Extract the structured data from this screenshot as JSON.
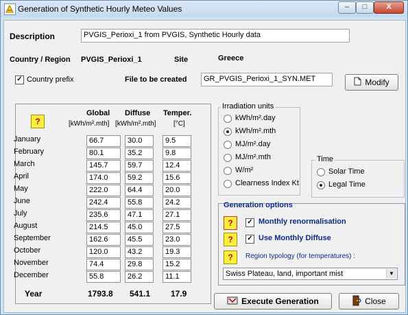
{
  "window": {
    "title": "Generation of Synthetic Hourly Meteo Values",
    "minimize": "–",
    "maximize": "□",
    "close": "X"
  },
  "description": {
    "label": "Description",
    "value": "PVGIS_Perioxi_1  from PVGIS, Synthetic Hourly data"
  },
  "location": {
    "country_label": "Country / Region",
    "country_value": "PVGIS_Perioxi_1",
    "site_label": "Site",
    "site_value": "Greece"
  },
  "country_prefix": {
    "label": "Country prefix",
    "checked": true
  },
  "file": {
    "label": "File to be created",
    "value": "GR_PVGIS_Perioxi_1_SYN.MET",
    "modify_label": "Modify"
  },
  "table": {
    "help": "?",
    "headers": [
      {
        "name": "Global",
        "unit": "[kWh/m².mth]"
      },
      {
        "name": "Diffuse",
        "unit": "[kWh/m².mth]"
      },
      {
        "name": "Temper.",
        "unit": "[°C]"
      }
    ],
    "rows": [
      {
        "month": "January",
        "global": "66.7",
        "diffuse": "30.0",
        "temp": "9.5"
      },
      {
        "month": "February",
        "global": "80.1",
        "diffuse": "35.2",
        "temp": "9.8"
      },
      {
        "month": "March",
        "global": "145.7",
        "diffuse": "59.7",
        "temp": "12.4"
      },
      {
        "month": "April",
        "global": "174.0",
        "diffuse": "59.2",
        "temp": "15.6"
      },
      {
        "month": "May",
        "global": "222.0",
        "diffuse": "64.4",
        "temp": "20.0"
      },
      {
        "month": "June",
        "global": "242.4",
        "diffuse": "55.8",
        "temp": "24.2"
      },
      {
        "month": "July",
        "global": "235.6",
        "diffuse": "47.1",
        "temp": "27.1"
      },
      {
        "month": "August",
        "global": "214.5",
        "diffuse": "45.0",
        "temp": "27.5"
      },
      {
        "month": "September",
        "global": "162.6",
        "diffuse": "45.5",
        "temp": "23.0"
      },
      {
        "month": "October",
        "global": "120.0",
        "diffuse": "43.2",
        "temp": "19.3"
      },
      {
        "month": "November",
        "global": "74.4",
        "diffuse": "29.8",
        "temp": "15.2"
      },
      {
        "month": "December",
        "global": "55.8",
        "diffuse": "26.2",
        "temp": "11.1"
      }
    ],
    "year": {
      "label": "Year",
      "global": "1793.8",
      "diffuse": "541.1",
      "temp": "17.9"
    }
  },
  "irradiation_units": {
    "label": "Irradiation units",
    "options": [
      "kWh/m².day",
      "kWh/m².mth",
      "MJ/m².day",
      "MJ/m².mth",
      "W/m²",
      "Clearness Index Kt"
    ],
    "selected": "kWh/m².mth"
  },
  "time": {
    "label": "Time",
    "options": [
      "Solar Time",
      "Legal Time"
    ],
    "selected": "Legal Time"
  },
  "generation_options": {
    "label": "Generation options",
    "help": "?",
    "monthly_renorm": {
      "label": "Monthly renormalisation",
      "checked": true
    },
    "monthly_diffuse": {
      "label": "Use Monthly Diffuse",
      "checked": true
    },
    "region_label": "Region typology  (for temperatures) :",
    "region_value": "Swiss Plateau, land, important mist"
  },
  "buttons": {
    "execute": "Execute Generation",
    "close": "Close"
  },
  "colors": {
    "title_bar": "#c4d8ee",
    "help_yellow": "#ffef3b",
    "accent_blue": "#0d2a8a"
  }
}
